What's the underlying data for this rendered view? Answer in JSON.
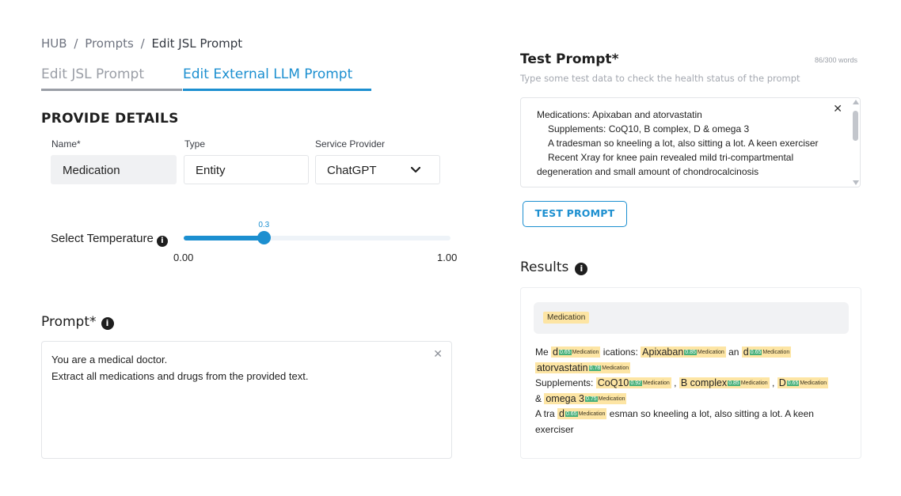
{
  "breadcrumb": {
    "hub": "HUB",
    "sep1": "/",
    "prompts": "Prompts",
    "sep2": "/",
    "current": "Edit JSL Prompt"
  },
  "tabs": [
    {
      "label": "Edit JSL Prompt",
      "active": false
    },
    {
      "label": "Edit External LLM Prompt",
      "active": true
    }
  ],
  "details": {
    "section_title": "PROVIDE DETAILS",
    "name_label": "Name*",
    "name_value": "Medication",
    "type_label": "Type",
    "type_value": "Entity",
    "provider_label": "Service Provider",
    "provider_value": "ChatGPT"
  },
  "temperature": {
    "label": "Select Temperature",
    "value": 0.3,
    "value_label": "0.3",
    "min_label": "0.00",
    "max_label": "1.00",
    "min": 0,
    "max": 1
  },
  "prompt": {
    "title": "Prompt*",
    "lines": [
      "You are a medical doctor.",
      "Extract all medications and drugs from the provided text."
    ]
  },
  "test": {
    "title": "Test Prompt*",
    "word_count": "86/300 words",
    "subtitle": "Type some test data to check the health status of the prompt",
    "lines": [
      "Medications: Apixaban and atorvastatin",
      "Supplements: CoQ10, B complex, D & omega 3",
      "A tradesman so kneeling a lot, also sitting a lot. A keen exerciser",
      "Recent Xray for knee pain revealed mild tri-compartmental",
      "degeneration and small amount of chondrocalcinosis"
    ],
    "button_label": "TEST PROMPT"
  },
  "results": {
    "title": "Results",
    "legend_label": "Medication",
    "entity_label": "Medication",
    "segments": [
      [
        {
          "t": "Me "
        },
        {
          "e": "d",
          "s": "0.65"
        },
        {
          "t": " ications: "
        },
        {
          "e": "Apixaban",
          "s": "0.85"
        },
        {
          "t": " an "
        },
        {
          "e": "d",
          "s": "0.65"
        },
        {
          "t": " "
        },
        {
          "e": "atorvastatin",
          "s": "0.78"
        }
      ],
      [
        {
          "t": "Supplements: "
        },
        {
          "e": "CoQ10",
          "s": "0.92"
        },
        {
          "t": " , "
        },
        {
          "e": "B complex",
          "s": "0.85"
        },
        {
          "t": " , "
        },
        {
          "e": "D",
          "s": "0.65"
        }
      ],
      [
        {
          "t": "& "
        },
        {
          "e": "omega 3",
          "s": "0.75"
        }
      ],
      [
        {
          "t": "A tra "
        },
        {
          "e": "d",
          "s": "0.65"
        },
        {
          "t": " esman so kneeling a lot, also sitting a lot. A keen exerciser"
        }
      ]
    ]
  },
  "colors": {
    "accent": "#1c8fd0",
    "highlight": "#fde5a4",
    "score": "#47b07a"
  },
  "icons": [
    "info-icon",
    "close-icon",
    "chevron-down-icon"
  ]
}
